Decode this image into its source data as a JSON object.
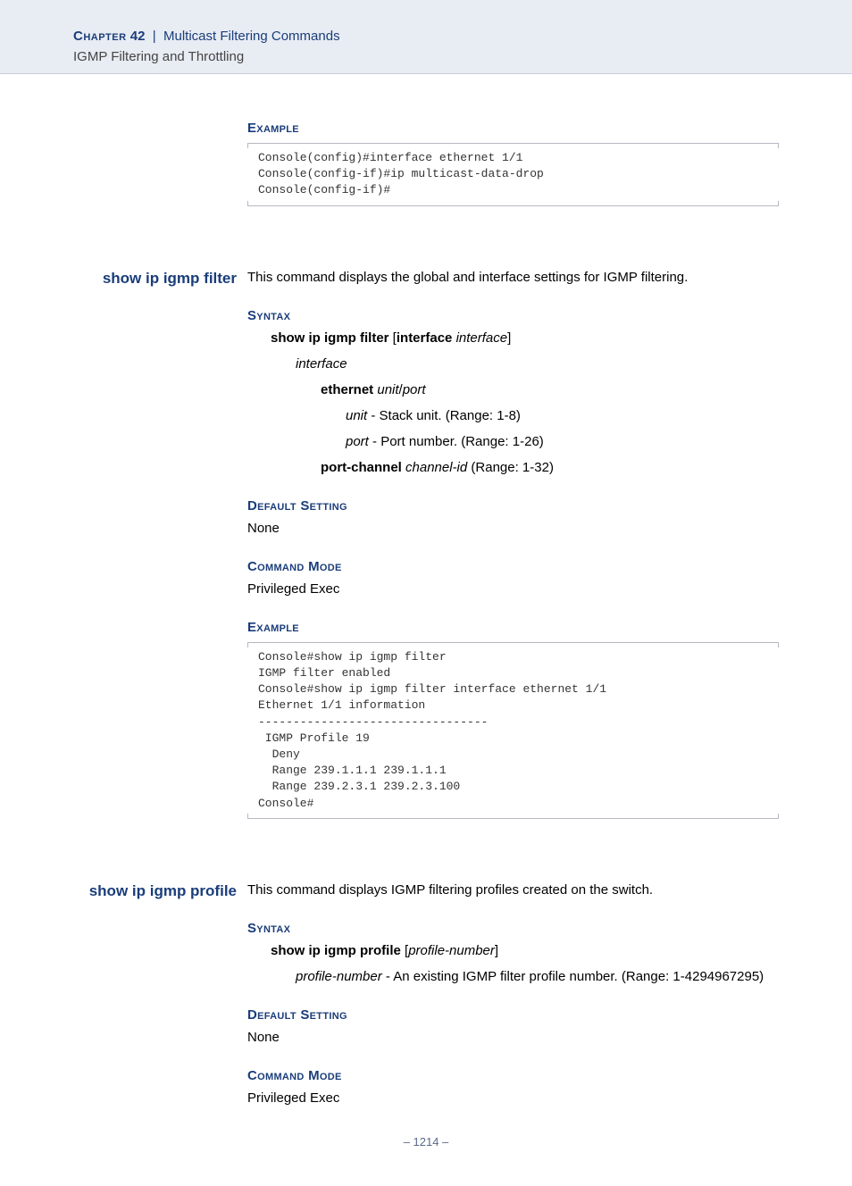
{
  "header": {
    "chapter_word": "Chapter",
    "chapter_num": "42",
    "sep": "|",
    "chapter_title": "Multicast Filtering Commands",
    "sub": "IGMP Filtering and Throttling"
  },
  "sec0": {
    "example_head": "Example",
    "code": "Console(config)#interface ethernet 1/1\nConsole(config-if)#ip multicast-data-drop\nConsole(config-if)#"
  },
  "cmd1": {
    "name": "show ip igmp filter",
    "desc": "This command displays the global and interface settings for IGMP filtering.",
    "syntax_head": "Syntax",
    "syn_line": "show ip igmp filter",
    "syn_open": " [",
    "syn_kw": "interface",
    "syn_sp": " ",
    "syn_arg": "interface",
    "syn_close": "]",
    "interface": "interface",
    "ethernet": "ethernet",
    "unitport_u": "unit",
    "unitport_sep": "/",
    "unitport_p": "port",
    "unit_i": "unit",
    "unit_desc": " - Stack unit. (Range: 1-8)",
    "port_i": "port",
    "port_desc": " - Port number. (Range: 1-26)",
    "pc": "port-channel",
    "pc_arg": "channel-id",
    "pc_desc": " (Range: 1-32)",
    "default_head": "Default Setting",
    "default_val": "None",
    "mode_head": "Command Mode",
    "mode_val": "Privileged Exec",
    "example_head": "Example",
    "code": "Console#show ip igmp filter\nIGMP filter enabled\nConsole#show ip igmp filter interface ethernet 1/1\nEthernet 1/1 information\n---------------------------------\n IGMP Profile 19\n  Deny\n  Range 239.1.1.1 239.1.1.1\n  Range 239.2.3.1 239.2.3.100\nConsole#"
  },
  "cmd2": {
    "name": "show ip igmp profile",
    "desc": "This command displays IGMP filtering profiles created on the switch.",
    "syntax_head": "Syntax",
    "syn_line": "show ip igmp profile",
    "syn_open": " [",
    "syn_arg": "profile-number",
    "syn_close": "]",
    "pn_i": "profile-number",
    "pn_desc": " - An existing IGMP filter profile number. (Range: 1-4294967295)",
    "default_head": "Default Setting",
    "default_val": "None",
    "mode_head": "Command Mode",
    "mode_val": "Privileged Exec"
  },
  "footer": {
    "page": "–  1214  –"
  }
}
